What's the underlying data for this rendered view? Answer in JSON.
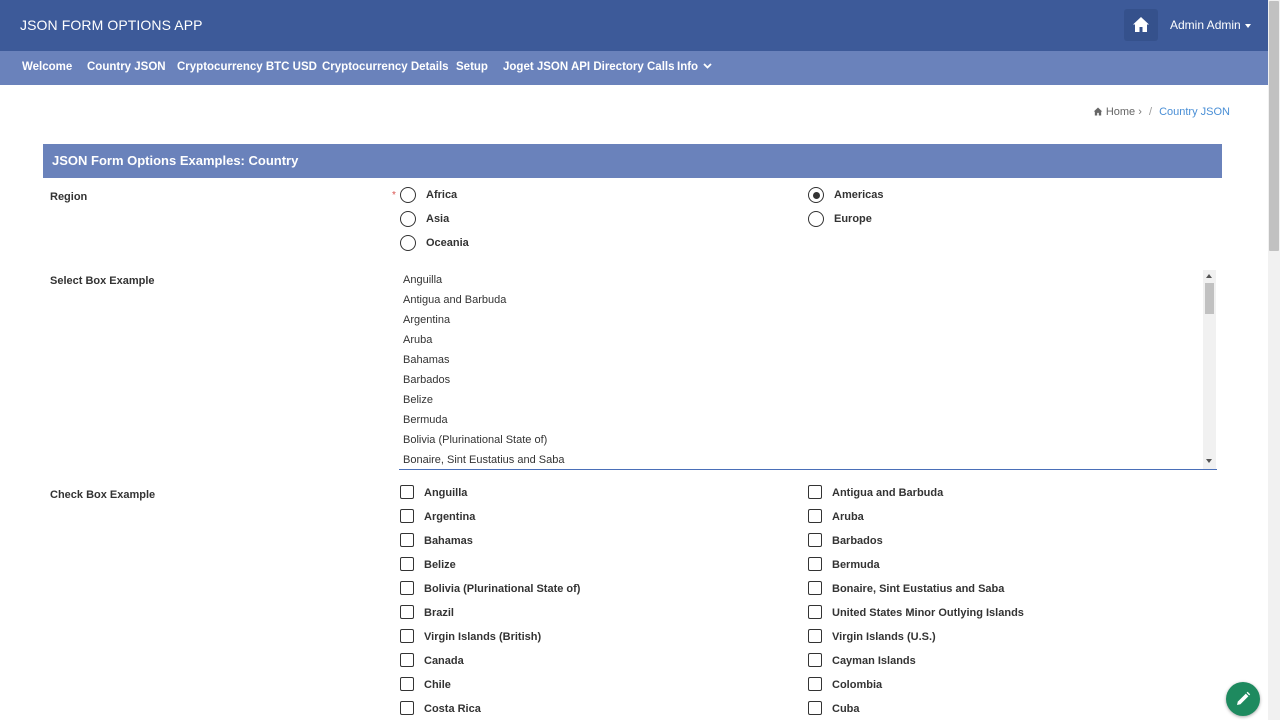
{
  "app": {
    "title": "JSON FORM OPTIONS APP"
  },
  "header": {
    "home_icon": "home-icon",
    "user_label": "Admin Admin"
  },
  "nav": {
    "items": [
      {
        "label": "Welcome"
      },
      {
        "label": "Country JSON"
      },
      {
        "label": "Cryptocurrency BTC USD"
      },
      {
        "label": "Cryptocurrency Details"
      },
      {
        "label": "Setup"
      },
      {
        "label": "Joget JSON API Directory Calls"
      },
      {
        "label": "Info"
      }
    ]
  },
  "breadcrumb": {
    "home": "Home",
    "separator": "/",
    "current": "Country JSON"
  },
  "form": {
    "title": "JSON Form Options Examples: Country",
    "region": {
      "label": "Region",
      "required_mark": "*",
      "options": [
        {
          "label": "Africa",
          "checked": false
        },
        {
          "label": "Americas",
          "checked": true
        },
        {
          "label": "Asia",
          "checked": false
        },
        {
          "label": "Europe",
          "checked": false
        },
        {
          "label": "Oceania",
          "checked": false
        }
      ]
    },
    "select_box": {
      "label": "Select Box Example",
      "options": [
        "Anguilla",
        "Antigua and Barbuda",
        "Argentina",
        "Aruba",
        "Bahamas",
        "Barbados",
        "Belize",
        "Bermuda",
        "Bolivia (Plurinational State of)",
        "Bonaire, Sint Eustatius and Saba"
      ]
    },
    "check_box": {
      "label": "Check Box Example",
      "options": [
        "Anguilla",
        "Antigua and Barbuda",
        "Argentina",
        "Aruba",
        "Bahamas",
        "Barbados",
        "Belize",
        "Bermuda",
        "Bolivia (Plurinational State of)",
        "Bonaire, Sint Eustatius and Saba",
        "Brazil",
        "United States Minor Outlying Islands",
        "Virgin Islands (British)",
        "Virgin Islands (U.S.)",
        "Canada",
        "Cayman Islands",
        "Chile",
        "Colombia",
        "Costa Rica",
        "Cuba"
      ]
    }
  },
  "fab": {
    "icon": "pencil-icon"
  }
}
